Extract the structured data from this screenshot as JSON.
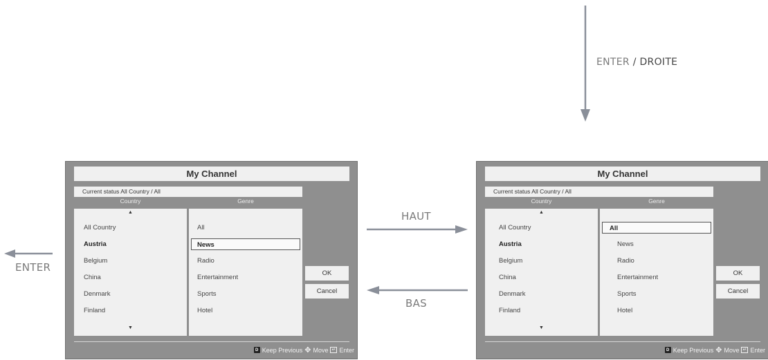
{
  "labels": {
    "enter_droite_part1": "ENTER",
    "enter_droite_part2": " / DROITE",
    "haut": "HAUT",
    "bas": "BAS",
    "enter_left": "ENTER"
  },
  "panels": [
    {
      "title": "My Channel",
      "status": "Current status All Country / All",
      "country_header": "Country",
      "genre_header": "Genre",
      "scroll_up": "▲",
      "scroll_down": "▼",
      "countries": [
        "All Country",
        "Austria",
        "Belgium",
        "China",
        "Denmark",
        "Finland"
      ],
      "genres": [
        "All",
        "News",
        "Radio",
        "Entertainment",
        "Sports",
        "Hotel"
      ],
      "selected_country": "Austria",
      "selected_genre": "News",
      "ok": "OK",
      "cancel": "Cancel",
      "footer": {
        "d_key": "D",
        "keep_previous": "Keep Previous",
        "move": "Move",
        "enter": "Enter"
      }
    },
    {
      "title": "My Channel",
      "status": "Current status All Country / All",
      "country_header": "Country",
      "genre_header": "Genre",
      "scroll_up": "▲",
      "scroll_down": "▼",
      "countries": [
        "All Country",
        "Austria",
        "Belgium",
        "China",
        "Denmark",
        "Finland"
      ],
      "genres": [
        "All",
        "News",
        "Radio",
        "Entertainment",
        "Sports",
        "Hotel"
      ],
      "selected_country": "Austria",
      "selected_genre": "All",
      "ok": "OK",
      "cancel": "Cancel",
      "footer": {
        "d_key": "D",
        "keep_previous": "Keep Previous",
        "move": "Move",
        "enter": "Enter"
      }
    }
  ],
  "colors": {
    "arrow": "#8a8f99",
    "panel_bg": "#8f8f8f",
    "list_bg": "#f0f0f0"
  }
}
